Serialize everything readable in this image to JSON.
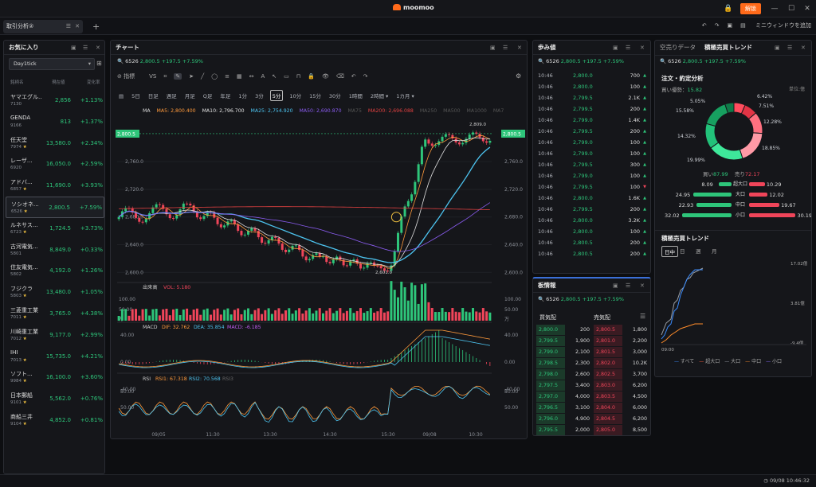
{
  "app": {
    "logo_text": "moomoo",
    "unlock_label": "解锁"
  },
  "tabs": {
    "active": "取引分析②",
    "mini_window": "ミニウィンドウを追加"
  },
  "watchlist": {
    "title": "お気に入り",
    "selector": "Day1tick",
    "col_name": "銘柄名",
    "col_price": "現在値",
    "col_change": "変化率",
    "items": [
      {
        "name": "ヤマエグル...",
        "code": "7130",
        "price": "2,856",
        "change": "+1.13%",
        "star": false
      },
      {
        "name": "GENDA",
        "code": "9166",
        "price": "813",
        "change": "+1.37%",
        "star": false
      },
      {
        "name": "任天堂",
        "code": "7974",
        "price": "13,580.0",
        "change": "+2.34%",
        "star": true
      },
      {
        "name": "レーザ...",
        "code": "6920",
        "price": "16,050.0",
        "change": "+2.59%",
        "star": false
      },
      {
        "name": "アドバ...",
        "code": "6857",
        "price": "11,690.0",
        "change": "+3.93%",
        "star": true
      },
      {
        "name": "ソシオネ...",
        "code": "6526",
        "price": "2,800.5",
        "change": "+7.59%",
        "star": true
      },
      {
        "name": "ルネサス...",
        "code": "6723",
        "price": "1,724.5",
        "change": "+3.73%",
        "star": true
      },
      {
        "name": "古河電気...",
        "code": "5801",
        "price": "8,849.0",
        "change": "+0.33%",
        "star": false
      },
      {
        "name": "住友電気...",
        "code": "5802",
        "price": "4,192.0",
        "change": "+1.26%",
        "star": false
      },
      {
        "name": "フジクラ",
        "code": "5803",
        "price": "13,480.0",
        "change": "+1.05%",
        "star": true
      },
      {
        "name": "三菱重工業",
        "code": "7011",
        "price": "3,765.0",
        "change": "+4.38%",
        "star": true
      },
      {
        "name": "川崎重工業",
        "code": "7012",
        "price": "9,177.0",
        "change": "+2.99%",
        "star": true
      },
      {
        "name": "IHI",
        "code": "7013",
        "price": "15,735.0",
        "change": "+4.21%",
        "star": true
      },
      {
        "name": "ソフト...",
        "code": "9984",
        "price": "16,100.0",
        "change": "+3.60%",
        "star": true
      },
      {
        "name": "日本郵船",
        "code": "9101",
        "price": "5,562.0",
        "change": "+0.76%",
        "star": true
      },
      {
        "name": "商船三井",
        "code": "9104",
        "price": "4,852.0",
        "change": "+0.81%",
        "star": true
      }
    ]
  },
  "chart": {
    "title": "チャート",
    "quote": {
      "code": "6526",
      "price": "2,800.5",
      "change": "+197.5",
      "pct": "+7.59%"
    },
    "toolbar_indicator": "指標",
    "toolbar_vs": "VS",
    "timeframes": [
      "5日",
      "日足",
      "週足",
      "月足",
      "Q足",
      "年足",
      "1分",
      "3分",
      "5分",
      "10分",
      "15分",
      "30分",
      "1時間",
      "2時間 ▾",
      "1カ月 ▾"
    ],
    "active_timeframe": "5分",
    "ma_legend": {
      "label": "MA",
      "ma5": "MA5: 2,800.400",
      "ma10": "MA10: 2,796.700",
      "ma25": "MA25: 2,754.920",
      "ma50": "MA50: 2,690.870",
      "ma75": "MA75",
      "ma200": "MA200: 2,696.088",
      "ma250": "MA250",
      "ma500": "MA500",
      "ma1000": "MA1000",
      "ma7": "MA7"
    },
    "price_ticks": [
      "2,760.0",
      "2,720.0",
      "2,680.0",
      "2,640.0",
      "2,600.0"
    ],
    "last_price": "2,800.5",
    "hi_label": "2,809.0",
    "lo_label": "2,601.0",
    "volume": {
      "label": "出来高",
      "value": "VOL: 5.180",
      "ticks": [
        "100.00",
        "50.00",
        "万"
      ]
    },
    "macd": {
      "label": "MACD",
      "dif": "DIF: 32.762",
      "dea": "DEA: 35.854",
      "macd": "MACD: -6.185",
      "ticks": [
        "40.00",
        "0.00",
        "-40.00"
      ]
    },
    "rsi": {
      "label": "RSI",
      "rsi1": "RSI1: 67.318",
      "rsi2": "RSI2: 70.568",
      "rsi3": "RSI3",
      "ticks": [
        "80.00",
        "50.00"
      ]
    },
    "x_labels": [
      "09/05",
      "11:30",
      "13:30",
      "14:30",
      "15:30",
      "09/08",
      "10:30"
    ],
    "colors": {
      "up": "#2ec57a",
      "down": "#f0455a",
      "ma5": "#ff9a3c",
      "ma10": "#e0e0e0",
      "ma25": "#4dc4f0",
      "ma50": "#8a5cf0",
      "ma200": "#e04040"
    }
  },
  "time_sales": {
    "title": "歩み値",
    "quote": {
      "code": "6526",
      "price": "2,800.5",
      "change": "+197.5",
      "pct": "+7.59%"
    },
    "rows": [
      {
        "t": "10:46",
        "p": "2,800.0",
        "v": "700",
        "d": "up"
      },
      {
        "t": "10:46",
        "p": "2,800.0",
        "v": "100",
        "d": "up"
      },
      {
        "t": "10:46",
        "p": "2,799.5",
        "v": "2.1K",
        "d": "up"
      },
      {
        "t": "10:46",
        "p": "2,799.5",
        "v": "200",
        "d": "up"
      },
      {
        "t": "10:46",
        "p": "2,799.0",
        "v": "1.4K",
        "d": "up"
      },
      {
        "t": "10:46",
        "p": "2,799.5",
        "v": "200",
        "d": "up"
      },
      {
        "t": "10:46",
        "p": "2,799.0",
        "v": "100",
        "d": "up"
      },
      {
        "t": "10:46",
        "p": "2,799.0",
        "v": "100",
        "d": "up"
      },
      {
        "t": "10:46",
        "p": "2,799.5",
        "v": "300",
        "d": "up"
      },
      {
        "t": "10:46",
        "p": "2,799.0",
        "v": "100",
        "d": "up"
      },
      {
        "t": "10:46",
        "p": "2,799.5",
        "v": "100",
        "d": "down"
      },
      {
        "t": "10:46",
        "p": "2,800.0",
        "v": "1.6K",
        "d": "up"
      },
      {
        "t": "10:46",
        "p": "2,799.5",
        "v": "200",
        "d": "up"
      },
      {
        "t": "10:46",
        "p": "2,800.0",
        "v": "3.2K",
        "d": "up"
      },
      {
        "t": "10:46",
        "p": "2,800.0",
        "v": "100",
        "d": "up"
      },
      {
        "t": "10:46",
        "p": "2,800.5",
        "v": "200",
        "d": "up"
      },
      {
        "t": "10:46",
        "p": "2,800.5",
        "v": "200",
        "d": "up"
      }
    ]
  },
  "order_book": {
    "title": "板情報",
    "quote": {
      "code": "6526",
      "price": "2,800.5",
      "change": "+197.5",
      "pct": "+7.59%"
    },
    "bid_label": "買気配",
    "ask_label": "売気配",
    "rows": [
      {
        "bp": "2,800.0",
        "bq": "200",
        "ap": "2,800.5",
        "aq": "1,800"
      },
      {
        "bp": "2,799.5",
        "bq": "1,900",
        "ap": "2,801.0",
        "aq": "2,200"
      },
      {
        "bp": "2,799.0",
        "bq": "2,100",
        "ap": "2,801.5",
        "aq": "3,000"
      },
      {
        "bp": "2,798.5",
        "bq": "2,300",
        "ap": "2,802.0",
        "aq": "10.2K"
      },
      {
        "bp": "2,798.0",
        "bq": "2,600",
        "ap": "2,802.5",
        "aq": "3,700"
      },
      {
        "bp": "2,797.5",
        "bq": "3,400",
        "ap": "2,803.0",
        "aq": "6,200"
      },
      {
        "bp": "2,797.0",
        "bq": "4,000",
        "ap": "2,803.5",
        "aq": "4,500"
      },
      {
        "bp": "2,796.5",
        "bq": "3,100",
        "ap": "2,804.0",
        "aq": "6,000"
      },
      {
        "bp": "2,796.0",
        "bq": "4,900",
        "ap": "2,804.5",
        "aq": "6,200"
      },
      {
        "bp": "2,795.5",
        "bq": "2,000",
        "ap": "2,805.0",
        "aq": "8,500"
      }
    ]
  },
  "analysis": {
    "tab1": "空売りデータ",
    "tab2": "積極売買トレンド",
    "quote": {
      "code": "6526",
      "price": "2,800.5",
      "change": "+197.5",
      "pct": "+7.59%"
    },
    "section": "注文・約定分析",
    "buy_ratio_label": "買い優勢：",
    "buy_ratio": "15.82",
    "unit": "単位:億",
    "donut": [
      {
        "label": "6.42%",
        "value": 6.42,
        "color": "#ff4d5e"
      },
      {
        "label": "7.51%",
        "value": 7.51,
        "color": "#e23445"
      },
      {
        "label": "12.28%",
        "value": 12.28,
        "color": "#ff7080"
      },
      {
        "label": "18.85%",
        "value": 18.85,
        "color": "#ff9aa6"
      },
      {
        "label": "19.99%",
        "value": 19.99,
        "color": "#3ee89a"
      },
      {
        "label": "14.32%",
        "value": 14.32,
        "color": "#22c27a"
      },
      {
        "label": "15.58%",
        "value": 15.58,
        "color": "#17a060"
      },
      {
        "label": "5.05%",
        "value": 5.05,
        "color": "#0f7a48"
      }
    ],
    "buy_total_label": "買い",
    "buy_total": "87.99",
    "sell_total_label": "売り",
    "sell_total": "72.17",
    "flows": [
      {
        "label": "超大口",
        "buy": "8.09",
        "sell": "10.29"
      },
      {
        "label": "大口",
        "buy": "24.95",
        "sell": "12.02"
      },
      {
        "label": "中口",
        "buy": "22.93",
        "sell": "19.67"
      },
      {
        "label": "小口",
        "buy": "32.02",
        "sell": "30.19"
      }
    ],
    "trend_title": "積極売買トレンド",
    "trend_tabs": [
      "日中",
      "日",
      "週",
      "月"
    ],
    "trend_active": "日中",
    "trend_ticks": [
      "17.02億",
      "3.81億",
      "-9.4億"
    ],
    "trend_x": "09:00",
    "trend_legend": [
      "すべて",
      "超大口",
      "大口",
      "中口",
      "小口"
    ]
  },
  "status": {
    "datetime": "09/08 10:46:32"
  }
}
